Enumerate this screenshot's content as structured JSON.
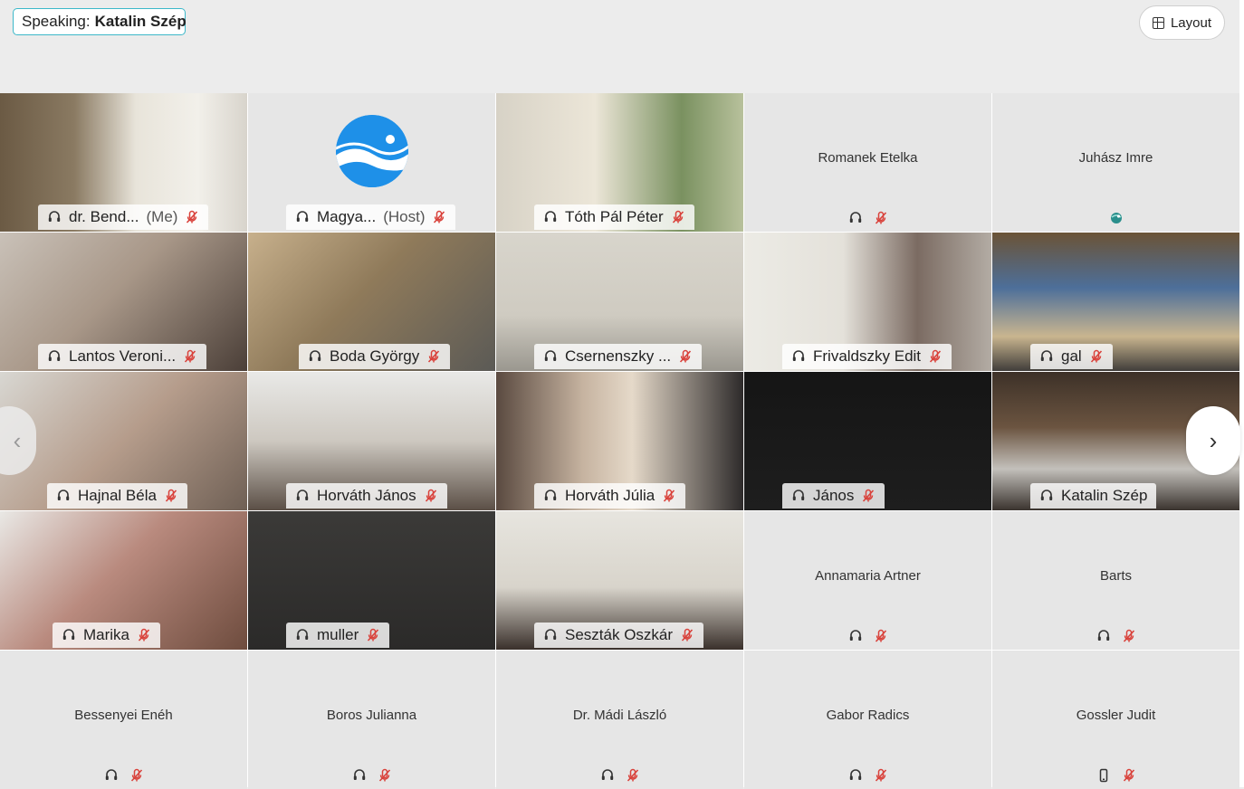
{
  "header": {
    "speaking_prefix": "Speaking:",
    "speaking_name": "Katalin Szép",
    "layout_label": "Layout"
  },
  "colors": {
    "active_border": "#1fa8e0",
    "speaking_border": "#3cb8c9",
    "muted_mic": "#d9413a",
    "tile_bg": "#e6e6e6"
  },
  "tiles": [
    {
      "name": "dr. Bend...",
      "tag": "(Me)",
      "video": true,
      "muted": true
    },
    {
      "name": "Magya...",
      "tag": "(Host)",
      "video": false,
      "logo": true,
      "muted": true
    },
    {
      "name": "Tóth Pál Péter",
      "video": true,
      "muted": true
    },
    {
      "name": "Romanek Etelka",
      "video": false,
      "muted": true
    },
    {
      "name": "Juhász Imre",
      "video": false,
      "status_icon": "globe-icon"
    },
    {
      "name": "Lantos Veroni...",
      "video": true,
      "muted": true
    },
    {
      "name": "Boda György",
      "video": true,
      "muted": true
    },
    {
      "name": "Csernenszky ...",
      "video": true,
      "muted": true
    },
    {
      "name": "Frivaldszky Edit",
      "video": true,
      "muted": true
    },
    {
      "name": "gal",
      "video": true,
      "muted": true
    },
    {
      "name": "Hajnal Béla",
      "video": true,
      "muted": true
    },
    {
      "name": "Horváth János",
      "video": true,
      "muted": true
    },
    {
      "name": "Horváth Júlia",
      "video": true,
      "muted": true
    },
    {
      "name": "János",
      "video": true,
      "muted": true,
      "dark": true
    },
    {
      "name": "Katalin Szép",
      "video": true,
      "muted": false,
      "active": true
    },
    {
      "name": "Marika",
      "video": true,
      "muted": true
    },
    {
      "name": "muller",
      "video": true,
      "muted": true
    },
    {
      "name": "Seszták Oszkár",
      "video": true,
      "muted": true
    },
    {
      "name": "Annamaria Artner",
      "video": false,
      "muted": true
    },
    {
      "name": "Barts",
      "video": false,
      "muted": true
    },
    {
      "name": "Bessenyei Enéh",
      "video": false,
      "muted": true
    },
    {
      "name": "Boros Julianna",
      "video": false,
      "muted": true
    },
    {
      "name": "Dr. Mádi László",
      "video": false,
      "muted": true
    },
    {
      "name": "Gabor Radics",
      "video": false,
      "muted": true
    },
    {
      "name": "Gossler Judit",
      "video": false,
      "muted": true,
      "device_icon": "phone-icon"
    }
  ]
}
